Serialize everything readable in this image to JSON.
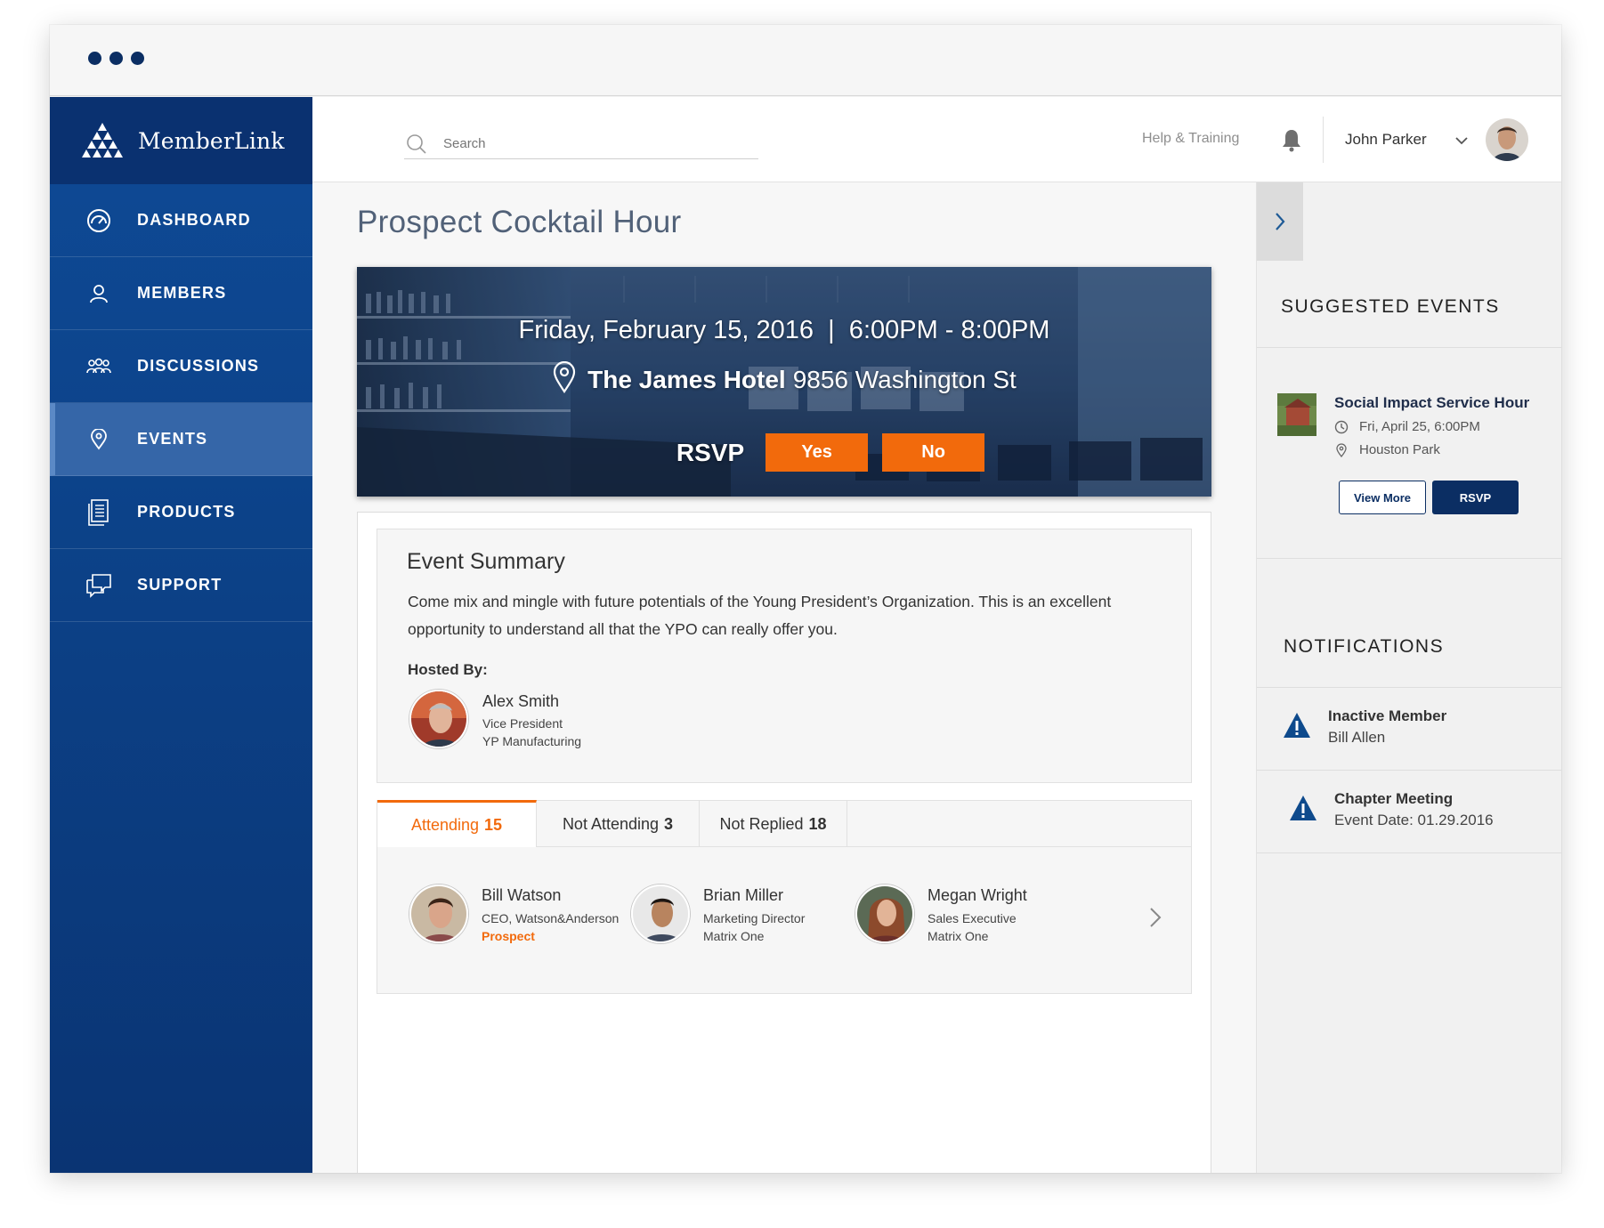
{
  "brand": {
    "name": "MemberLink"
  },
  "nav": {
    "items": [
      {
        "label": "DASHBOARD",
        "icon": "dashboard-icon",
        "active": false
      },
      {
        "label": "MEMBERS",
        "icon": "person-icon",
        "active": false
      },
      {
        "label": "DISCUSSIONS",
        "icon": "group-icon",
        "active": false
      },
      {
        "label": "EVENTS",
        "icon": "location-pin-icon",
        "active": true
      },
      {
        "label": "PRODUCTS",
        "icon": "document-icon",
        "active": false
      },
      {
        "label": "SUPPORT",
        "icon": "chat-bubbles-icon",
        "active": false
      }
    ]
  },
  "header": {
    "search_placeholder": "Search",
    "help_label": "Help & Training",
    "user_name": "John Parker"
  },
  "event": {
    "title": "Prospect Cocktail Hour",
    "datetime": "Friday, February 15, 2016  |  6:00PM - 8:00PM",
    "venue": "The James Hotel",
    "address": "9856 Washington St",
    "rsvp_label": "RSVP",
    "yes_label": "Yes",
    "no_label": "No"
  },
  "summary": {
    "heading": "Event Summary",
    "text": "Come mix and mingle with future potentials of the Young President’s Organization. This is an excellent opportunity to understand all that the YPO can really offer you.",
    "hosted_label": "Hosted By:",
    "host": {
      "name": "Alex Smith",
      "role": "Vice President",
      "company": "YP Manufacturing"
    }
  },
  "tabs": [
    {
      "label": "Attending",
      "count": "15",
      "active": true
    },
    {
      "label": "Not Attending",
      "count": "3",
      "active": false
    },
    {
      "label": "Not Replied",
      "count": "18",
      "active": false
    }
  ],
  "attendees": [
    {
      "name": "Bill Watson",
      "role": "CEO, Watson&Anderson",
      "company": "Prospect"
    },
    {
      "name": "Brian Miller",
      "role": "Marketing Director",
      "company": "Matrix One"
    },
    {
      "name": "Megan Wright",
      "role": "Sales Executive",
      "company": "Matrix One"
    }
  ],
  "suggested": {
    "heading": "SUGGESTED EVENTS",
    "event": {
      "title": "Social Impact Service Hour",
      "date": "Fri, April 25, 6:00PM",
      "location": "Houston Park",
      "view_more_label": "View More",
      "rsvp_label": "RSVP"
    }
  },
  "notifications": {
    "heading": "NOTIFICATIONS",
    "items": [
      {
        "title": "Inactive Member",
        "subtitle": "Bill Allen"
      },
      {
        "title": "Chapter Meeting",
        "subtitle": "Event Date: 01.29.2016"
      }
    ]
  },
  "colors": {
    "navy": "#0b2e63",
    "sidebar": "#0c4187",
    "accent_orange": "#f26a0c",
    "active_nav": "#3566a8"
  }
}
